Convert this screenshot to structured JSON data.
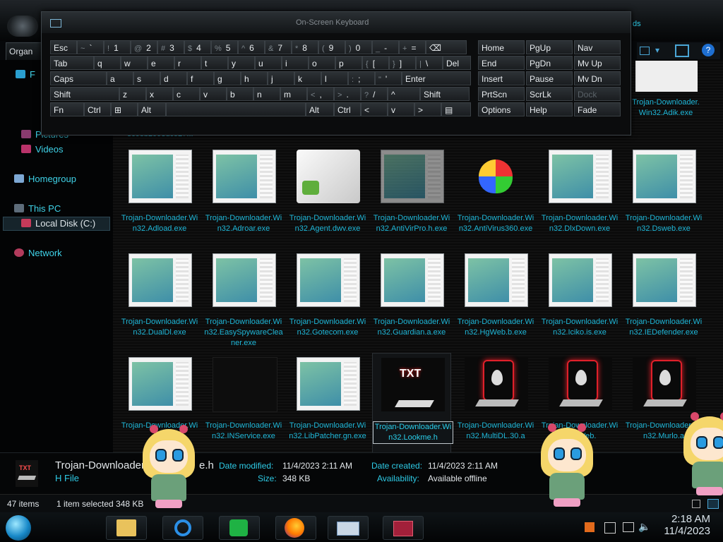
{
  "explorer": {
    "organize_label": "Organ",
    "nav_items": [
      {
        "label": "F"
      },
      {
        "label": "Pictures"
      },
      {
        "label": "Videos"
      },
      {
        "label": "Homegroup"
      },
      {
        "label": "This PC"
      },
      {
        "label": "Local Disk (C:)"
      },
      {
        "label": "Network"
      }
    ],
    "top_partial_label": "3c0eb2993dc527...",
    "top_right_file": "Trojan-Downloader.Win32.Adik.exe",
    "header_right_partial": "ds",
    "files": [
      {
        "name": "Trojan-Downloader.Win32.Adload.exe",
        "icon": "doc-thumbnail"
      },
      {
        "name": "Trojan-Downloader.Win32.Adroar.exe",
        "icon": "doc-thumbnail"
      },
      {
        "name": "Trojan-Downloader.Win32.Agent.dwv.exe",
        "icon": "cube-installer"
      },
      {
        "name": "Trojan-Downloader.Win32.AntiVirPro.h.exe",
        "icon": "doc-thumbnail-dim"
      },
      {
        "name": "Trojan-Downloader.Win32.AntiVirus360.exe",
        "icon": "shield-360"
      },
      {
        "name": "Trojan-Downloader.Win32.DlxDown.exe",
        "icon": "doc-thumbnail"
      },
      {
        "name": "Trojan-Downloader.Win32.Dsweb.exe",
        "icon": "doc-thumbnail"
      },
      {
        "name": "Trojan-Downloader.Win32.DualDl.exe",
        "icon": "doc-thumbnail"
      },
      {
        "name": "Trojan-Downloader.Win32.EasySpywareCleaner.exe",
        "icon": "doc-thumbnail"
      },
      {
        "name": "Trojan-Downloader.Win32.Gotecom.exe",
        "icon": "doc-thumbnail"
      },
      {
        "name": "Trojan-Downloader.Win32.Guardian.a.exe",
        "icon": "doc-thumbnail"
      },
      {
        "name": "Trojan-Downloader.Win32.HgWeb.b.exe",
        "icon": "doc-thumbnail"
      },
      {
        "name": "Trojan-Downloader.Win32.Iciko.is.exe",
        "icon": "doc-thumbnail"
      },
      {
        "name": "Trojan-Downloader.Win32.IEDefender.exe",
        "icon": "doc-thumbnail"
      },
      {
        "name": "Trojan-Downloader.Win3",
        "icon": "doc-thumbnail"
      },
      {
        "name": "Trojan-Downloader.Win32.INService.exe",
        "icon": "blank"
      },
      {
        "name": "Trojan-Downloader.Win32.LibPatcher.gn.exe",
        "icon": "doc-thumbnail"
      },
      {
        "name": "Trojan-Downloader.Win32.Lookme.h",
        "icon": "txt-file",
        "selected": true
      },
      {
        "name": "Trojan-Downloader.Win32.MultiDL.30.a",
        "icon": "alien-red"
      },
      {
        "name": "Trojan-Downloader.Win32.Web.",
        "icon": "alien-red"
      },
      {
        "name": "Trojan-Downloader.Win32.Murlo.a",
        "icon": "alien-red"
      }
    ],
    "details": {
      "filename": "Trojan-Downloader.W",
      "filename_tail": "e.h",
      "type": "H File",
      "date_modified_label": "Date modified:",
      "date_modified": "11/4/2023 2:11 AM",
      "size_label": "Size:",
      "size": "348 KB",
      "date_created_label": "Date created:",
      "date_created": "11/4/2023 2:11 AM",
      "availability_label": "Availability:",
      "availability": "Available offline",
      "thumb_text": "TXT"
    },
    "status": {
      "items_count": "47 items",
      "selection": "1 item selected  348 KB"
    }
  },
  "keyboard": {
    "title": "On-Screen Keyboard",
    "rows": [
      [
        {
          "t": "Esc"
        },
        {
          "s": "~",
          "t": "`"
        },
        {
          "s": "!",
          "t": "1"
        },
        {
          "s": "@",
          "t": "2"
        },
        {
          "s": "#",
          "t": "3"
        },
        {
          "s": "$",
          "t": "4"
        },
        {
          "s": "%",
          "t": "5"
        },
        {
          "s": "^",
          "t": "6"
        },
        {
          "s": "&",
          "t": "7"
        },
        {
          "s": "*",
          "t": "8"
        },
        {
          "s": "(",
          "t": "9"
        },
        {
          "s": ")",
          "t": "0"
        },
        {
          "s": "_",
          "t": "-"
        },
        {
          "s": "+",
          "t": "="
        },
        {
          "t": "⌫"
        }
      ],
      [
        {
          "t": "Tab"
        },
        {
          "t": "q"
        },
        {
          "t": "w"
        },
        {
          "t": "e"
        },
        {
          "t": "r"
        },
        {
          "t": "t"
        },
        {
          "t": "y"
        },
        {
          "t": "u"
        },
        {
          "t": "i"
        },
        {
          "t": "o"
        },
        {
          "t": "p"
        },
        {
          "s": "{",
          "t": "["
        },
        {
          "s": "}",
          "t": "]"
        },
        {
          "s": "|",
          "t": "\\"
        },
        {
          "t": "Del"
        }
      ],
      [
        {
          "t": "Caps"
        },
        {
          "t": "a"
        },
        {
          "t": "s"
        },
        {
          "t": "d"
        },
        {
          "t": "f"
        },
        {
          "t": "g"
        },
        {
          "t": "h"
        },
        {
          "t": "j"
        },
        {
          "t": "k"
        },
        {
          "t": "l"
        },
        {
          "s": ":",
          "t": ";"
        },
        {
          "s": "\"",
          "t": "'"
        },
        {
          "t": "Enter"
        }
      ],
      [
        {
          "t": "Shift"
        },
        {
          "t": "z"
        },
        {
          "t": "x"
        },
        {
          "t": "c"
        },
        {
          "t": "v"
        },
        {
          "t": "b"
        },
        {
          "t": "n"
        },
        {
          "t": "m"
        },
        {
          "s": "<",
          "t": ","
        },
        {
          "s": ">",
          "t": "."
        },
        {
          "s": "?",
          "t": "/"
        },
        {
          "t": "^"
        },
        {
          "t": "Shift"
        }
      ],
      [
        {
          "t": "Fn"
        },
        {
          "t": "Ctrl"
        },
        {
          "t": "⊞"
        },
        {
          "t": "Alt"
        },
        {
          "t": ""
        },
        {
          "t": "Alt"
        },
        {
          "t": "Ctrl"
        },
        {
          "t": "<"
        },
        {
          "t": "v"
        },
        {
          "t": ">"
        },
        {
          "t": "▤"
        }
      ]
    ],
    "right_keys": [
      [
        "Home",
        "PgUp",
        "Nav"
      ],
      [
        "End",
        "PgDn",
        "Mv Up"
      ],
      [
        "Insert",
        "Pause",
        "Mv Dn"
      ],
      [
        "PrtScn",
        "ScrLk",
        "Dock"
      ],
      [
        "Options",
        "Help",
        "Fade"
      ]
    ]
  },
  "taskbar": {
    "clock_time": "2:18 AM",
    "clock_date": "11/4/2023",
    "pinned": [
      "file-explorer-icon",
      "internet-explorer-icon",
      "spreadsheet-icon",
      "firefox-icon",
      "keyboard-icon",
      "media-icon"
    ]
  },
  "colors": {
    "accent_cyan": "#1fb7d8",
    "nav_cyan": "#3fd2e8",
    "alien_red": "#e0202a"
  }
}
